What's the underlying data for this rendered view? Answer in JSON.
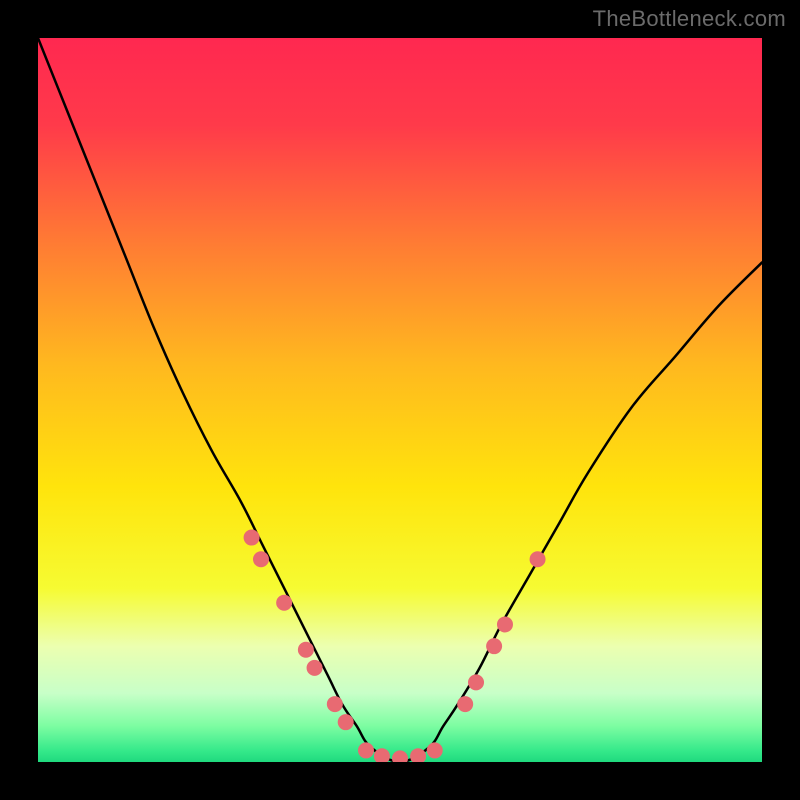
{
  "watermark": "TheBottleneck.com",
  "chart_data": {
    "type": "line",
    "title": "",
    "xlabel": "",
    "ylabel": "",
    "xlim": [
      0,
      100
    ],
    "ylim": [
      0,
      100
    ],
    "gradient_stops": [
      {
        "offset": 0.0,
        "color": "#ff2850"
      },
      {
        "offset": 0.12,
        "color": "#ff3a4a"
      },
      {
        "offset": 0.28,
        "color": "#ff7a34"
      },
      {
        "offset": 0.45,
        "color": "#ffb81f"
      },
      {
        "offset": 0.62,
        "color": "#ffe40c"
      },
      {
        "offset": 0.76,
        "color": "#f6fb32"
      },
      {
        "offset": 0.84,
        "color": "#ecffb0"
      },
      {
        "offset": 0.905,
        "color": "#c8ffc8"
      },
      {
        "offset": 0.95,
        "color": "#7dfda2"
      },
      {
        "offset": 0.985,
        "color": "#34e98a"
      },
      {
        "offset": 1.0,
        "color": "#1fd97e"
      }
    ],
    "series": [
      {
        "name": "bottleneck-curve",
        "x": [
          0,
          4,
          8,
          12,
          16,
          20,
          24,
          28,
          31,
          34,
          37,
          40,
          42,
          44,
          46,
          50,
          54,
          56,
          58,
          61,
          64,
          68,
          72,
          76,
          82,
          88,
          94,
          100
        ],
        "y": [
          100,
          90,
          80,
          70,
          60,
          51,
          43,
          36,
          30,
          24,
          18,
          12,
          8,
          5,
          2,
          0,
          2,
          5,
          8,
          13,
          19,
          26,
          33,
          40,
          49,
          56,
          63,
          69
        ]
      }
    ],
    "markers": [
      {
        "x": 29.5,
        "y": 31
      },
      {
        "x": 30.8,
        "y": 28
      },
      {
        "x": 34.0,
        "y": 22
      },
      {
        "x": 37.0,
        "y": 15.5
      },
      {
        "x": 38.2,
        "y": 13
      },
      {
        "x": 41.0,
        "y": 8
      },
      {
        "x": 42.5,
        "y": 5.5
      },
      {
        "x": 45.3,
        "y": 1.6
      },
      {
        "x": 47.5,
        "y": 0.8
      },
      {
        "x": 50.0,
        "y": 0.5
      },
      {
        "x": 52.5,
        "y": 0.8
      },
      {
        "x": 54.8,
        "y": 1.6
      },
      {
        "x": 59.0,
        "y": 8
      },
      {
        "x": 60.5,
        "y": 11
      },
      {
        "x": 63.0,
        "y": 16
      },
      {
        "x": 64.5,
        "y": 19
      },
      {
        "x": 69.0,
        "y": 28
      }
    ],
    "marker_color": "#e86a72",
    "marker_radius_px": 8
  }
}
